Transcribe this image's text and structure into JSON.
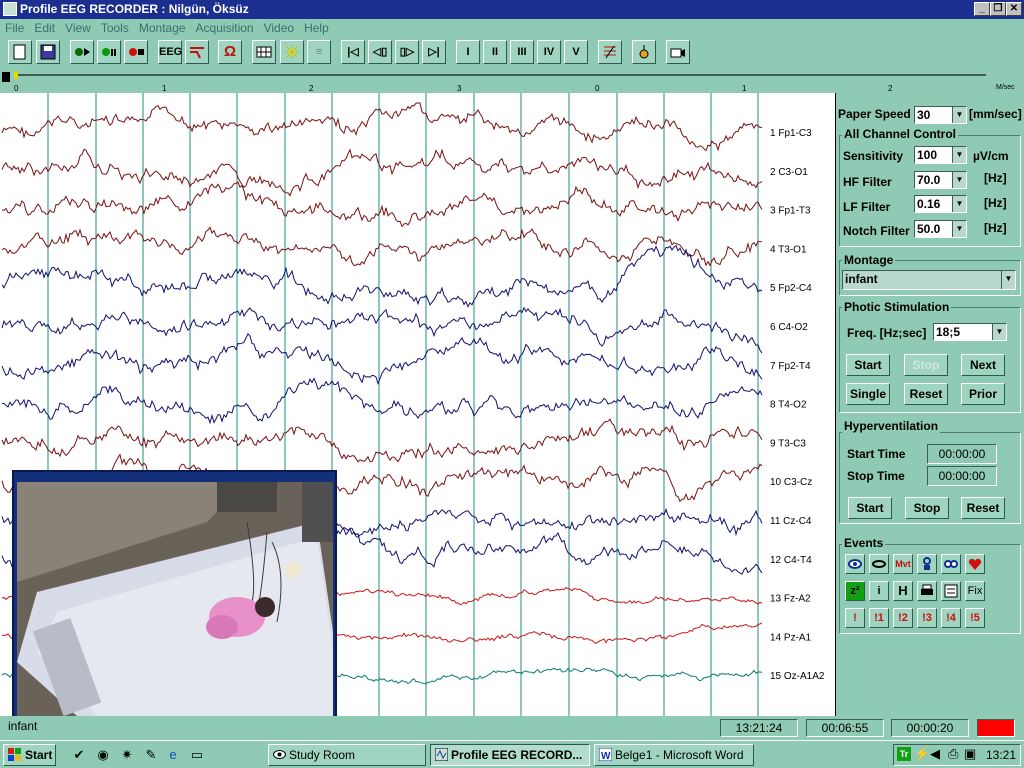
{
  "window": {
    "title": "Profile EEG RECORDER : Nilgün, Öksüz",
    "controls": [
      "_",
      "❐",
      "✕"
    ]
  },
  "menu": [
    "File",
    "Edit",
    "View",
    "Tools",
    "Montage",
    "Acquisition",
    "Video",
    "Help"
  ],
  "toolbar": {
    "buttons": [
      "new-icon",
      "save-icon",
      "record-icon",
      "pause-icon",
      "stop-icon",
      "EEG",
      "impedance-icon",
      "ohm-icon",
      "grid-icon",
      "flash-icon",
      "calibrate-icon",
      "first-icon",
      "prev-page-icon",
      "next-page-icon",
      "last-icon",
      "I",
      "II",
      "III",
      "IV",
      "V",
      "montage-icon",
      "marker-icon",
      "camera-icon"
    ],
    "roman": [
      "I",
      "II",
      "III",
      "IV",
      "V"
    ],
    "eeg_label": "EEG",
    "ohm_label": "Ω"
  },
  "ruler": {
    "ticks": [
      "0",
      "1",
      "2",
      "3",
      "0",
      "1",
      "2"
    ],
    "unit": "M/sec"
  },
  "channels": [
    {
      "label": "1  Fp1-C3",
      "color": "#7a1010"
    },
    {
      "label": "2  C3-O1",
      "color": "#7a1010"
    },
    {
      "label": "3  Fp1-T3",
      "color": "#7a1010"
    },
    {
      "label": "4  T3-O1",
      "color": "#7a1010"
    },
    {
      "label": "5  Fp2-C4",
      "color": "#101070"
    },
    {
      "label": "6  C4-O2",
      "color": "#101070"
    },
    {
      "label": "7  Fp2-T4",
      "color": "#101070"
    },
    {
      "label": "8  T4-O2",
      "color": "#101070"
    },
    {
      "label": "9  T3-C3",
      "color": "#7a1010"
    },
    {
      "label": "10  C3-Cz",
      "color": "#7a1010"
    },
    {
      "label": "11  Cz-C4",
      "color": "#101070"
    },
    {
      "label": "12  C4-T4",
      "color": "#101070"
    },
    {
      "label": "13  Fz-A2",
      "color": "#c81818"
    },
    {
      "label": "14  Pz-A1",
      "color": "#c81818"
    },
    {
      "label": "15  Oz-A1A2",
      "color": "#0a7a6a"
    }
  ],
  "controls": {
    "paper_speed_label": "Paper Speed",
    "paper_speed_value": "30",
    "paper_speed_unit": "[mm/sec]",
    "all_channel_title": "All Channel Control",
    "sensitivity_label": "Sensitivity",
    "sensitivity_value": "100",
    "sensitivity_unit": "µV/cm",
    "hf_label": "HF Filter",
    "hf_value": "70.0",
    "hf_unit": "[Hz]",
    "lf_label": "LF Filter",
    "lf_value": "0.16",
    "lf_unit": "[Hz]",
    "notch_label": "Notch Filter",
    "notch_value": "50.0",
    "notch_unit": "[Hz]"
  },
  "montage": {
    "title": "Montage",
    "value": "infant"
  },
  "photic": {
    "title": "Photic Stimulation",
    "freq_label": "Freq. [Hz;sec]",
    "freq_value": "18;5",
    "buttons": {
      "start": "Start",
      "stop": "Stop",
      "next": "Next",
      "single": "Single",
      "reset": "Reset",
      "prior": "Prior"
    }
  },
  "hyper": {
    "title": "Hyperventilation",
    "start_time_label": "Start Time",
    "start_time_value": "00:00:00",
    "stop_time_label": "Stop Time",
    "stop_time_value": "00:00:00",
    "buttons": {
      "start": "Start",
      "stop": "Stop",
      "reset": "Reset"
    }
  },
  "events": {
    "title": "Events",
    "row1": [
      "eye-icon",
      "mouth-icon",
      "Mvt",
      "person-icon",
      "eyes-open-icon",
      "heart-icon"
    ],
    "row2": [
      "z²",
      "i",
      "H",
      "print-icon",
      "list-icon",
      "Fix"
    ],
    "row3": [
      "!",
      "!1",
      "!2",
      "!3",
      "!4",
      "!5"
    ]
  },
  "status": {
    "montage_name": "infant",
    "clock": "13:21:24",
    "elapsed": "00:06:55",
    "page_time": "00:00:20",
    "record_color": "#ff0000"
  },
  "taskbar": {
    "start_label": "Start",
    "tasks": [
      {
        "label": "Study Room",
        "active": false
      },
      {
        "label": "Profile EEG RECORD...",
        "active": true
      },
      {
        "label": "Belge1 - Microsoft Word",
        "active": false
      }
    ],
    "time": "13:21"
  }
}
